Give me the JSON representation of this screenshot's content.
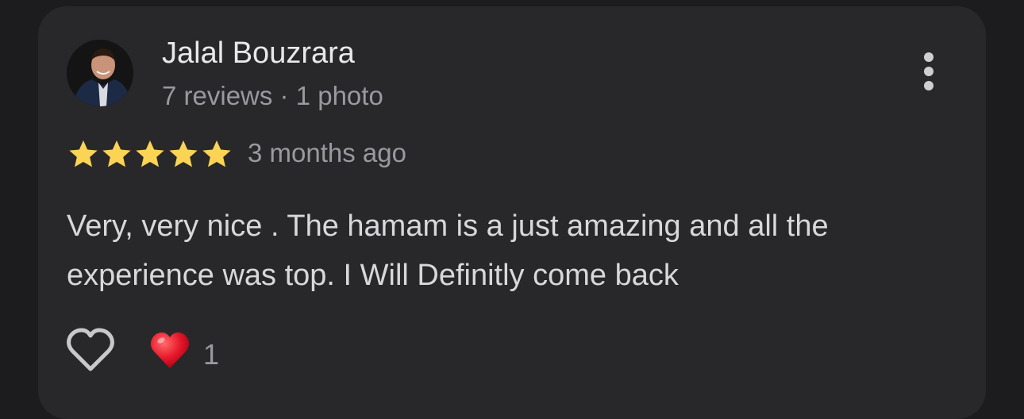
{
  "review": {
    "author_name": "Jalal Bouzrara",
    "author_meta": "7 reviews · 1 photo",
    "rating": 5,
    "rating_max": 5,
    "time": "3 months ago",
    "text": "Very, very nice . The hamam is a just amazing and all the experience was top. I Will Definitly come back",
    "reaction_count": "1"
  },
  "icons": {
    "more": "more-vert-icon",
    "like": "heart-outline-icon",
    "reaction": "red-heart-emoji-icon",
    "star": "star-icon"
  },
  "colors": {
    "background": "#1c1c1e",
    "card": "#28282b",
    "star": "#fcd455",
    "reaction": "#e8192c"
  }
}
